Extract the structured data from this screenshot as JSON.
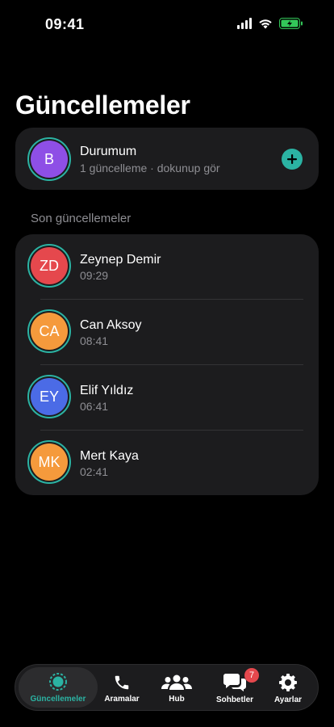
{
  "status_bar": {
    "time": "09:41"
  },
  "title": "Güncellemeler",
  "my_status": {
    "initial": "B",
    "name": "Durumum",
    "subtitle": "1 güncelleme · dokunup gör",
    "avatar_color": "#8e4fe6"
  },
  "recent_label": "Son güncellemeler",
  "recent": [
    {
      "initials": "ZD",
      "name": "Zeynep Demir",
      "time": "09:29",
      "color": "#e5484d"
    },
    {
      "initials": "CA",
      "name": "Can Aksoy",
      "time": "08:41",
      "color": "#f59a3c"
    },
    {
      "initials": "EY",
      "name": "Elif Yıldız",
      "time": "06:41",
      "color": "#4b6be6"
    },
    {
      "initials": "MK",
      "name": "Mert Kaya",
      "time": "02:41",
      "color": "#f59a3c"
    }
  ],
  "accent": "#2bb3a3",
  "tabs": [
    {
      "label": "Güncellemeler",
      "icon": "updates-icon",
      "active": true
    },
    {
      "label": "Aramalar",
      "icon": "phone-icon"
    },
    {
      "label": "Hub",
      "icon": "people-icon"
    },
    {
      "label": "Sohbetler",
      "icon": "chat-icon",
      "badge": "7"
    },
    {
      "label": "Ayarlar",
      "icon": "gear-icon"
    }
  ]
}
